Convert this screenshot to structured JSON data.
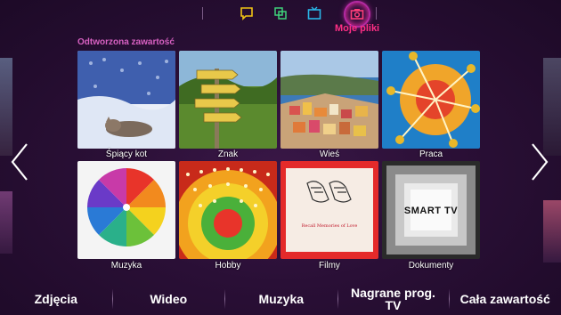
{
  "top_nav": {
    "items": [
      {
        "icon": "chat-icon",
        "label": ""
      },
      {
        "icon": "apps-icon",
        "label": ""
      },
      {
        "icon": "tv-icon",
        "label": ""
      },
      {
        "icon": "camera-icon",
        "label": "Moje pliki",
        "active": true
      }
    ]
  },
  "section_title": "Odtworzona zawartość",
  "tiles": [
    {
      "caption": "Śpiący kot"
    },
    {
      "caption": "Znak"
    },
    {
      "caption": "Wieś"
    },
    {
      "caption": "Praca"
    },
    {
      "caption": "Muzyka"
    },
    {
      "caption": "Hobby"
    },
    {
      "caption": "Filmy",
      "inner_text": "Recall Memories of Love"
    },
    {
      "caption": "Dokumenty",
      "inner_text": "SMART TV"
    }
  ],
  "bottom_nav": {
    "items": [
      "Zdjęcia",
      "Wideo",
      "Muzyka",
      "Nagrane prog. TV",
      "Cała zawartość"
    ]
  },
  "colors": {
    "accent": "#ff2f86",
    "section_label": "#d861c2",
    "background": "#2a0f36"
  }
}
